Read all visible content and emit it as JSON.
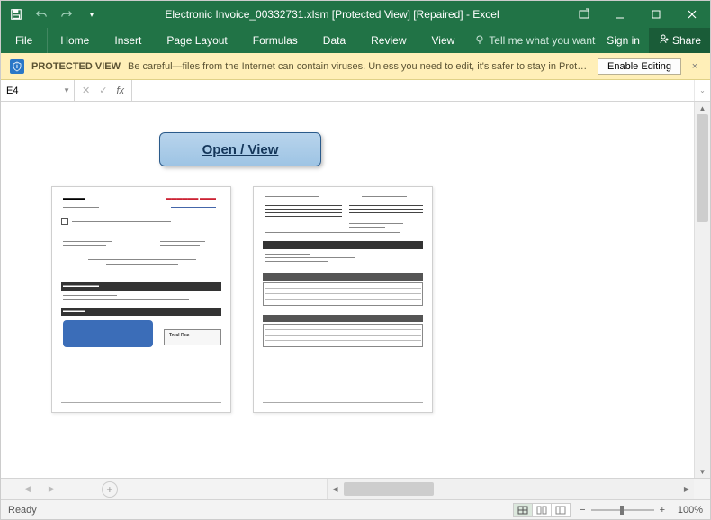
{
  "titlebar": {
    "title": "Electronic Invoice_00332731.xlsm  [Protected View] [Repaired] - Excel"
  },
  "ribbon": {
    "file": "File",
    "tabs": [
      "Home",
      "Insert",
      "Page Layout",
      "Formulas",
      "Data",
      "Review",
      "View"
    ],
    "tell_me_placeholder": "Tell me what you want to do...",
    "signin": "Sign in",
    "share": "Share"
  },
  "protected_view": {
    "title": "PROTECTED VIEW",
    "message": "Be careful—files from the Internet can contain viruses. Unless you need to edit, it's safer to stay in Protected View.",
    "enable": "Enable Editing"
  },
  "formula_bar": {
    "cell_ref": "E4",
    "fx": "fx",
    "value": ""
  },
  "sheet": {
    "open_view": "Open / View"
  },
  "status": {
    "ready": "Ready",
    "zoom": "100%"
  }
}
